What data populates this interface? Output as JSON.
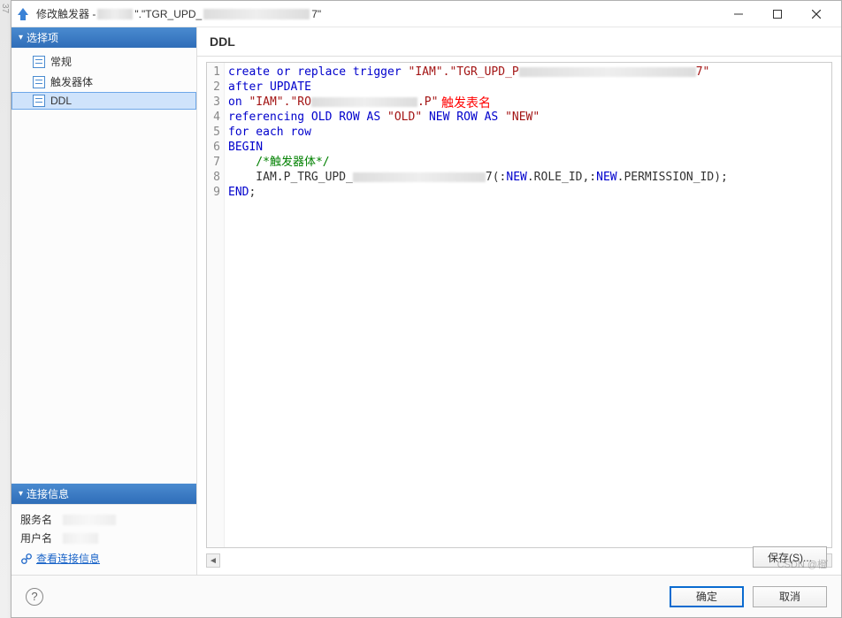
{
  "window": {
    "title_prefix": "修改触发器 - ",
    "title_mid": "\".\"TGR_UPD_",
    "title_suffix": "7\""
  },
  "sidebar": {
    "options_header": "选择项",
    "items": [
      {
        "label": "常规"
      },
      {
        "label": "触发器体"
      },
      {
        "label": "DDL"
      }
    ],
    "selected_index": 2,
    "conn_header": "连接信息",
    "conn_service_label": "服务名",
    "conn_user_label": "用户名",
    "conn_link": "查看连接信息"
  },
  "main": {
    "header": "DDL",
    "annotation": "触发表名",
    "code_lines": [
      {
        "n": 1,
        "segments": [
          {
            "t": "create or replace trigger ",
            "c": "kw"
          },
          {
            "t": "\"IAM\".\"TGR_UPD_P",
            "c": "str"
          },
          {
            "blur": 200
          },
          {
            "t": "7\"",
            "c": "str"
          }
        ]
      },
      {
        "n": 2,
        "segments": [
          {
            "t": "after UPDATE",
            "c": "kw"
          }
        ]
      },
      {
        "n": 3,
        "segments": [
          {
            "t": "on ",
            "c": "kw"
          },
          {
            "t": "\"IAM\".\"RO",
            "c": "str"
          },
          {
            "blur": 120
          },
          {
            "t": ".P\"",
            "c": "str"
          }
        ]
      },
      {
        "n": 4,
        "segments": [
          {
            "t": "referencing OLD ROW AS ",
            "c": "kw"
          },
          {
            "t": "\"OLD\"",
            "c": "str"
          },
          {
            "t": " NEW ROW AS ",
            "c": "kw"
          },
          {
            "t": "\"NEW\"",
            "c": "str"
          }
        ]
      },
      {
        "n": 5,
        "segments": [
          {
            "t": "for each row",
            "c": "kw"
          }
        ]
      },
      {
        "n": 6,
        "segments": [
          {
            "t": "BEGIN",
            "c": "kw"
          }
        ]
      },
      {
        "n": 7,
        "segments": [
          {
            "t": "    /*触发器体*/",
            "c": "cmt"
          }
        ]
      },
      {
        "n": 8,
        "segments": [
          {
            "t": "    IAM.P_TRG_UPD_"
          },
          {
            "blur": 150
          },
          {
            "t": "7(:"
          },
          {
            "t": "NEW",
            "c": "kw"
          },
          {
            "t": ".ROLE_ID,:"
          },
          {
            "t": "NEW",
            "c": "kw"
          },
          {
            "t": ".PERMISSION_ID);"
          }
        ]
      },
      {
        "n": 9,
        "segments": [
          {
            "t": "END",
            "c": "kw"
          },
          {
            "t": ";"
          }
        ]
      }
    ]
  },
  "buttons": {
    "save": "保存(S)...",
    "ok": "确定",
    "cancel": "取消"
  },
  "watermark": "CSDN @橙",
  "chart_data": null
}
